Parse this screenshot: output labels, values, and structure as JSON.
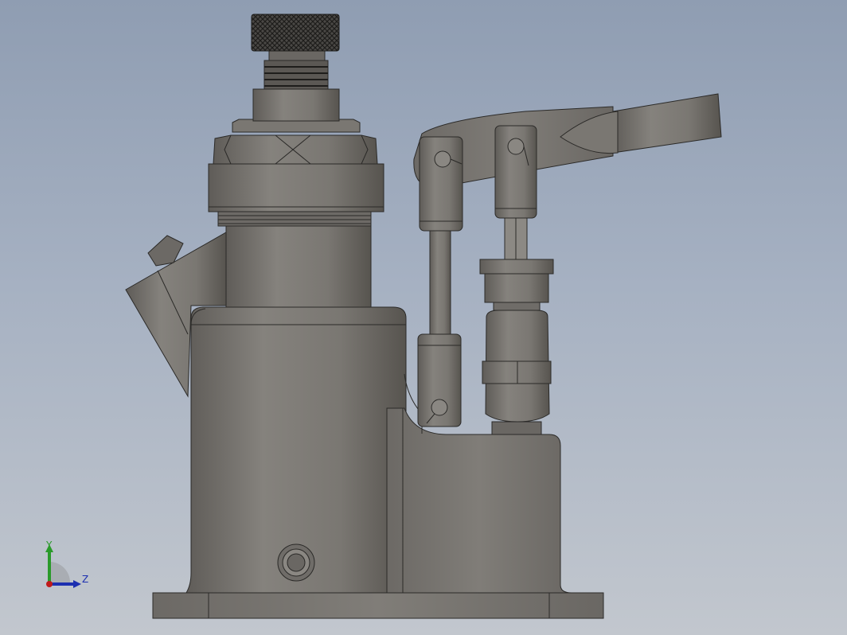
{
  "triad": {
    "y_label": "Y",
    "z_label": "Z"
  },
  "colors": {
    "background_top": "#8f9db2",
    "background_bottom": "#c2c7ce",
    "metal": "#7f7c78",
    "metal_dark": "#5d5a56",
    "edge": "#2b2a28",
    "axis_y": "#2a9a2a",
    "axis_z": "#1c2fb0",
    "axis_x": "#c01b1b"
  }
}
